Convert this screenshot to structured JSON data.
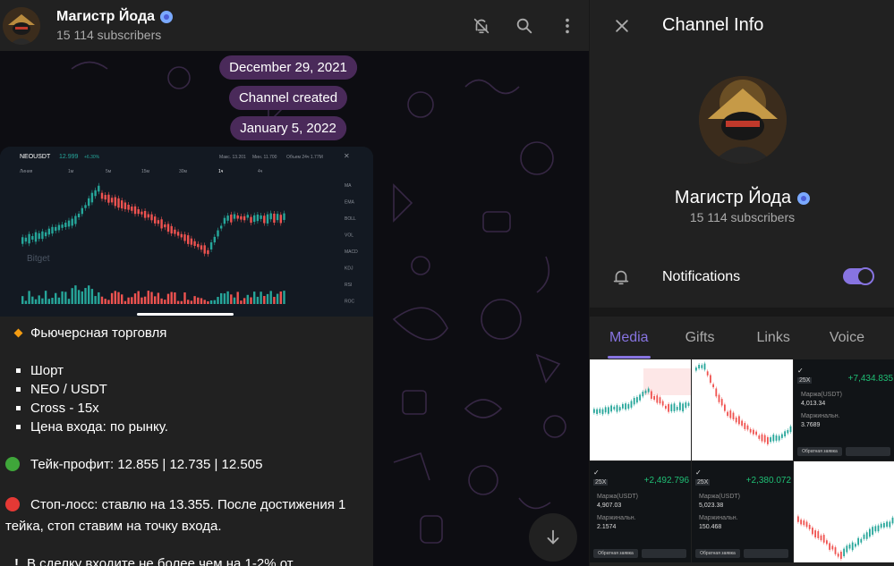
{
  "chat": {
    "title": "Магистр Йода",
    "subtitle": "15 114 subscribers",
    "header_icons": [
      "bell-muted-icon",
      "search-icon",
      "more-vertical-icon"
    ],
    "service_pills": [
      "December 29, 2021",
      "Channel created",
      "January 5, 2022"
    ]
  },
  "message": {
    "chart_preview": {
      "pair": "NEOUSDT",
      "price": "12.999",
      "change": "+6.30%",
      "max_label": "Макс. 13.201",
      "min_label": "Мин. 11.700",
      "volume_label": "Объем 24ч 1.77M",
      "timeframes": [
        "Линия",
        "1м",
        "5м",
        "15м",
        "30м",
        "1ч",
        "4ч"
      ],
      "right_indicators": [
        "MA",
        "EMA",
        "BOLL",
        "VOL",
        "MACD",
        "KDJ",
        "RSI",
        "ROC"
      ],
      "watermark": "Bitget"
    },
    "lines": [
      {
        "icon": "orange-diamond-icon",
        "text": "Фьючерсная торговля"
      },
      {
        "icon": "gap",
        "text": ""
      },
      {
        "icon": "square-bullet-icon",
        "text": "Шорт"
      },
      {
        "icon": "square-bullet-icon",
        "text": "NEO / USDT"
      },
      {
        "icon": "square-bullet-icon",
        "text": "Cross - 15x"
      },
      {
        "icon": "square-bullet-icon",
        "text": "Цена входа: по рынку."
      },
      {
        "icon": "gap",
        "text": ""
      },
      {
        "icon": "green-circle-icon",
        "text": "Тейк-профит: 12.855 | 12.735 | 12.505"
      },
      {
        "icon": "gap",
        "text": ""
      },
      {
        "icon": "red-circle-icon",
        "text": "Стоп-лосс: ставлю на 13.355. После достижения 1",
        "continuation": "тейка, стоп ставим на точку входа."
      },
      {
        "icon": "gap",
        "text": ""
      },
      {
        "icon": "exclamation-icon",
        "text": "В сделку входите не более чем на 1-2% от"
      }
    ]
  },
  "panel": {
    "title": "Channel Info",
    "name": "Магистр Йода",
    "subtitle": "15 114 subscribers",
    "notifications_label": "Notifications",
    "notifications_on": true,
    "tabs": [
      "Media",
      "Gifts",
      "Links",
      "Voice"
    ],
    "active_tab": "Media",
    "thumbs": [
      {
        "kind": "light"
      },
      {
        "kind": "light"
      },
      {
        "kind": "dark",
        "value": "+7,434.835",
        "lev": "25X",
        "margin_label": "Маржа(USDT)",
        "margin": "4,013.34",
        "mm_label": "Маржинальн.",
        "mm": "3.7689",
        "btn": "Обратная заявка"
      },
      {
        "kind": "dark",
        "value": "+2,492.796",
        "lev": "25X",
        "margin_label": "Маржа(USDT)",
        "margin": "4,907.03",
        "mm_label": "Маржинальн.",
        "mm": "2.1574",
        "btn": "Обратная заявка"
      },
      {
        "kind": "dark",
        "value": "+2,380.072",
        "lev": "25X",
        "margin_label": "Маржа(USDT)",
        "margin": "5,023.38",
        "mm_label": "Маржинальн.",
        "mm": "150.468",
        "btn": "Обратная заявка"
      },
      {
        "kind": "light"
      }
    ]
  },
  "colors": {
    "accent": "#8774e1",
    "pill": "#4a2a5a",
    "up": "#26a69a",
    "down": "#ef5350"
  }
}
